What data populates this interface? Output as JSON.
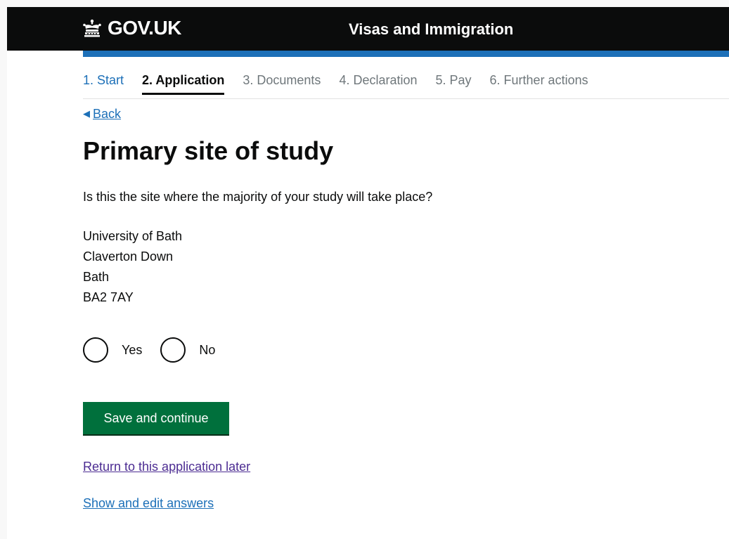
{
  "header": {
    "logo_text": "GOV.UK",
    "logo_icon": "crown-icon",
    "service_name": "Visas and Immigration"
  },
  "steps": [
    {
      "label": "1. Start",
      "state": "done"
    },
    {
      "label": "2. Application",
      "state": "current"
    },
    {
      "label": "3. Documents",
      "state": "upcoming"
    },
    {
      "label": "4. Declaration",
      "state": "upcoming"
    },
    {
      "label": "5. Pay",
      "state": "upcoming"
    },
    {
      "label": "6. Further actions",
      "state": "upcoming"
    }
  ],
  "back": {
    "label": "Back",
    "icon": "triangle-left-icon"
  },
  "page": {
    "title": "Primary site of study",
    "question": "Is this the site where the majority of your study will take place?"
  },
  "address": [
    "University of Bath",
    "Claverton Down",
    "Bath",
    "BA2 7AY"
  ],
  "radios": [
    {
      "label": "Yes",
      "checked": false
    },
    {
      "label": "No",
      "checked": false
    }
  ],
  "actions": {
    "save_label": "Save and continue",
    "return_label": "Return to this application later",
    "show_label": "Show and edit answers"
  },
  "colors": {
    "header_bg": "#0b0c0c",
    "header_accent": "#1d70b8",
    "button_green": "#00703c",
    "link_blue": "#1d70b8",
    "visited_link": "#4c2c92"
  }
}
